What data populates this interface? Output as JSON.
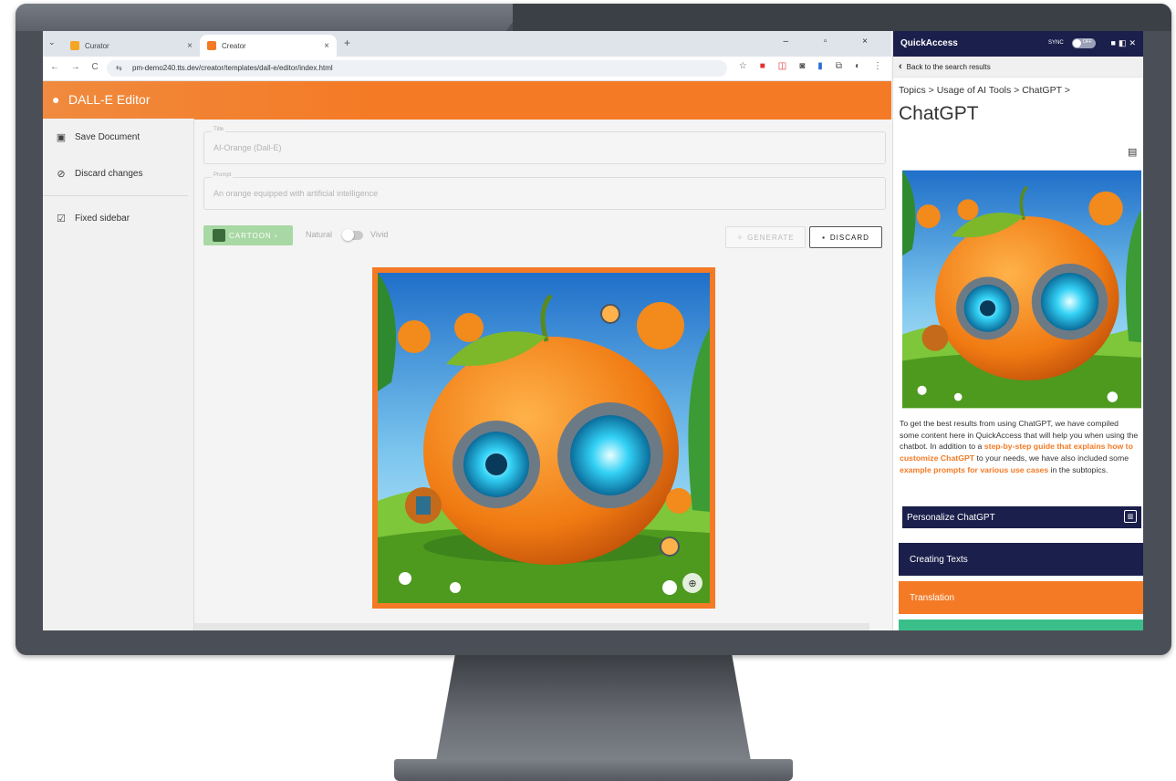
{
  "browser": {
    "tabs": [
      {
        "label": "Curator",
        "close": "×"
      },
      {
        "label": "Creator",
        "close": "×"
      }
    ],
    "tab_menu": "⌄",
    "new_tab": "+",
    "window_controls": "– ▫ ×",
    "nav": "← → C",
    "url": "pm-demo240.tts.dev/creator/templates/dall-e/editor/index.html"
  },
  "app": {
    "title": "DALL-E Editor",
    "sidebar": [
      {
        "label": "Save Document",
        "icon": "save-icon"
      },
      {
        "label": "Discard changes",
        "icon": "block-icon"
      },
      {
        "label": "Fixed sidebar",
        "icon": "checkbox-icon"
      }
    ],
    "form": {
      "title_label": "Title",
      "title_value": "AI-Orange (Dall-E)",
      "prompt_label": "Prompt",
      "prompt_value": "An orange equipped with artificial intelligence"
    },
    "style_button": "CARTOON ›",
    "toggle_left": "Natural",
    "toggle_right": "Vivid",
    "generate_button": "GENERATE",
    "discard_button": "DISCARD"
  },
  "quickaccess": {
    "title": "QuickAccess",
    "sync_label": "SYNC",
    "sync_state": "OFF",
    "back_label": "Back to the search results",
    "breadcrumb": "Topics > Usage of AI Tools > ChatGPT >",
    "heading": "ChatGPT",
    "body_1": "To get the best results from using ChatGPT, we have compiled some content here in QuickAccess that will help you when using the chatbot. In addition to a ",
    "link_1": "step-by-step guide that explains how to customize ChatGPT",
    "body_2": " to your needs, we have also included some ",
    "link_2": "example prompts for various use cases",
    "body_3": " in the subtopics.",
    "personalize": "Personalize ChatGPT",
    "blocks": [
      {
        "label": "Creating Texts",
        "color": "#1b1f4b"
      },
      {
        "label": "Translation",
        "color": "#f47a25"
      },
      {
        "label": "",
        "color": "#3bbf8a"
      }
    ]
  },
  "colors": {
    "accent": "#f47a25",
    "navy": "#1b1f4b",
    "green": "#a8d8a4"
  }
}
